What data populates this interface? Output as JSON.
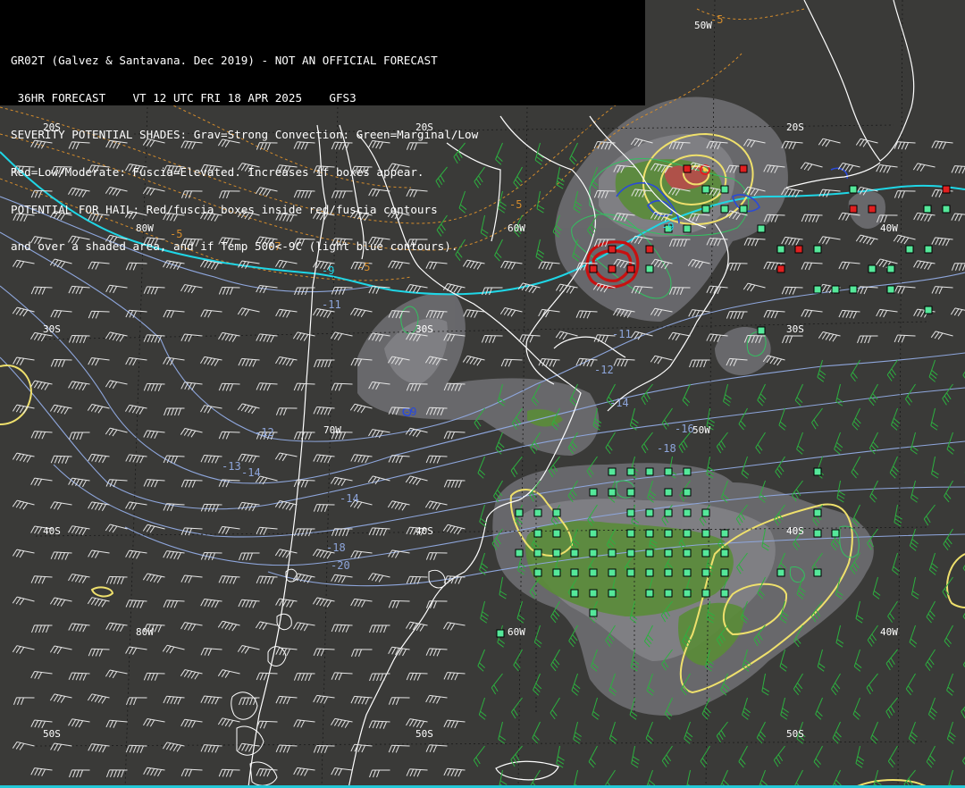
{
  "header": {
    "lines": [
      "GR02T (Galvez & Santavana. Dec 2019) - NOT AN OFFICIAL FORECAST",
      " 36HR FORECAST    VT 12 UTC FRI 18 APR 2025    GFS3",
      "SEVERITY POTENTIAL SHADES: Grav=Strong Convection: Green=Marginal/Low",
      "Red=Low/Moderate: Fuscia=Elevated. Increases if boxes appear.",
      "POTENTIAL FOR HAIL: Red/fuscia boxes inside red/fuscia contours",
      "and over a shaded area, and if Temp 500<-9C (light blue contours)."
    ]
  },
  "grid_labels": {
    "lat_20s": "20S",
    "lat_30s": "30S",
    "lat_40s": "40S",
    "lat_50s": "50S",
    "lon_80w": "80W",
    "lon_70w": "70W",
    "lon_60w": "60W",
    "lon_50w": "50W",
    "lon_40w": "40W"
  },
  "contour_labels": {
    "cyan_9": "-9",
    "orange_5": "-5",
    "orange_5b": "-5",
    "orange_5c": "-5",
    "orange_5d": "-5",
    "orange_7": "-7",
    "blue_11": "-11",
    "blue_12": "-12",
    "blue_12b": "-12",
    "blue_13": "-13",
    "blue_14": "-14",
    "blue_14b": "-14",
    "blue_14c": "-14",
    "blue_16": "-16",
    "blue_18": "-18",
    "blue_18b": "-18",
    "blue_20": "-20",
    "blue_9": "-9"
  },
  "colors": {
    "background": "#3a3a38",
    "header_bg": "#000000",
    "shade_gray": "#6e6e72",
    "shade_gray_light": "#8a8a8e",
    "shade_green": "#5e8a3a",
    "shade_red": "#c04040",
    "box_green": "#55e89a",
    "box_red": "#e02020",
    "contour_yellow": "#f0e070",
    "contour_cyan": "#20d8e8",
    "contour_blue_light": "#8fa8e0",
    "contour_orange": "#d89030",
    "contour_red": "#cc1010",
    "coastline": "#ffffff",
    "wind_barb_white": "#e8e8e8",
    "wind_barb_green": "#30b040"
  },
  "legend": {
    "boxes": "markers indicate severity potential grid points"
  }
}
